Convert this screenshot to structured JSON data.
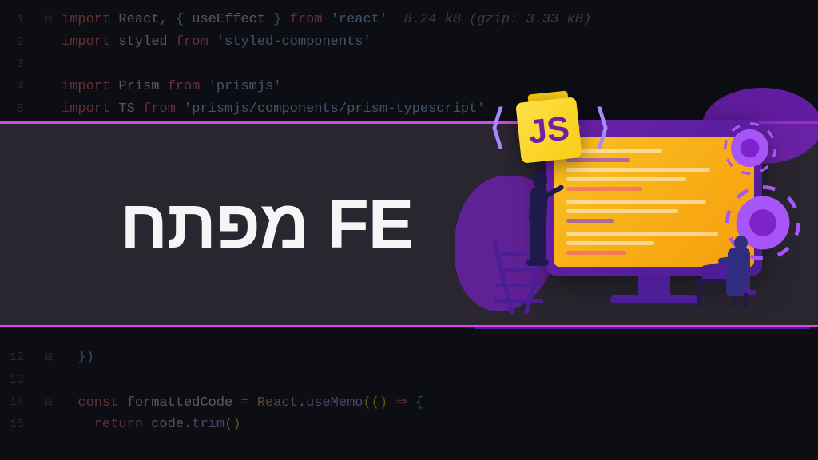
{
  "banner": {
    "title": "מפתח FE"
  },
  "js_badge": "JS",
  "code": {
    "lines": [
      {
        "n": "1",
        "gutter": "⊟",
        "parts": [
          {
            "t": "import ",
            "c": "kw-import"
          },
          {
            "t": "React",
            "c": "kw-module"
          },
          {
            "t": ", ",
            "c": "kw-punct"
          },
          {
            "t": "{ ",
            "c": "kw-brace"
          },
          {
            "t": "useEffect ",
            "c": "kw-module"
          },
          {
            "t": "} ",
            "c": "kw-brace"
          },
          {
            "t": "from ",
            "c": "kw-from"
          },
          {
            "t": "'react'",
            "c": "kw-string"
          },
          {
            "t": "  8.24 kB (gzip: 3.33 kB)",
            "c": "kw-comment"
          }
        ]
      },
      {
        "n": "2",
        "gutter": "",
        "parts": [
          {
            "t": "import ",
            "c": "kw-import"
          },
          {
            "t": "styled ",
            "c": "kw-module"
          },
          {
            "t": "from ",
            "c": "kw-from"
          },
          {
            "t": "'styled-components'",
            "c": "kw-string"
          }
        ]
      },
      {
        "n": "3",
        "gutter": "",
        "parts": []
      },
      {
        "n": "4",
        "gutter": "",
        "parts": [
          {
            "t": "import ",
            "c": "kw-import"
          },
          {
            "t": "Prism ",
            "c": "kw-module"
          },
          {
            "t": "from ",
            "c": "kw-from"
          },
          {
            "t": "'prismjs'",
            "c": "kw-string"
          }
        ]
      },
      {
        "n": "5",
        "gutter": "",
        "parts": [
          {
            "t": "import ",
            "c": "kw-import"
          },
          {
            "t": "TS ",
            "c": "kw-module"
          },
          {
            "t": "from ",
            "c": "kw-from"
          },
          {
            "t": "'prismjs/components/prism-typescript'",
            "c": "kw-string"
          }
        ]
      },
      {
        "n": "12",
        "gutter": "⊟",
        "parts": [
          {
            "t": "  ",
            "c": ""
          },
          {
            "t": "})",
            "c": "kw-brace"
          }
        ]
      },
      {
        "n": "13",
        "gutter": "",
        "parts": []
      },
      {
        "n": "14",
        "gutter": "⊟",
        "parts": [
          {
            "t": "  ",
            "c": ""
          },
          {
            "t": "const ",
            "c": "kw-const"
          },
          {
            "t": "formattedCode ",
            "c": "kw-var"
          },
          {
            "t": "= ",
            "c": "kw-punct"
          },
          {
            "t": "React",
            "c": "kw-obj"
          },
          {
            "t": ".",
            "c": "kw-punct"
          },
          {
            "t": "useMemo",
            "c": "kw-method"
          },
          {
            "t": "(() ",
            "c": "kw-paren"
          },
          {
            "t": "⇒ ",
            "c": "kw-arrow"
          },
          {
            "t": "{",
            "c": "kw-brace"
          }
        ]
      },
      {
        "n": "15",
        "gutter": "",
        "parts": [
          {
            "t": "    ",
            "c": ""
          },
          {
            "t": "return ",
            "c": "kw-return"
          },
          {
            "t": "code",
            "c": "kw-var"
          },
          {
            "t": ".",
            "c": "kw-punct"
          },
          {
            "t": "trim",
            "c": "kw-method"
          },
          {
            "t": "()",
            "c": "kw-paren"
          }
        ]
      }
    ]
  }
}
